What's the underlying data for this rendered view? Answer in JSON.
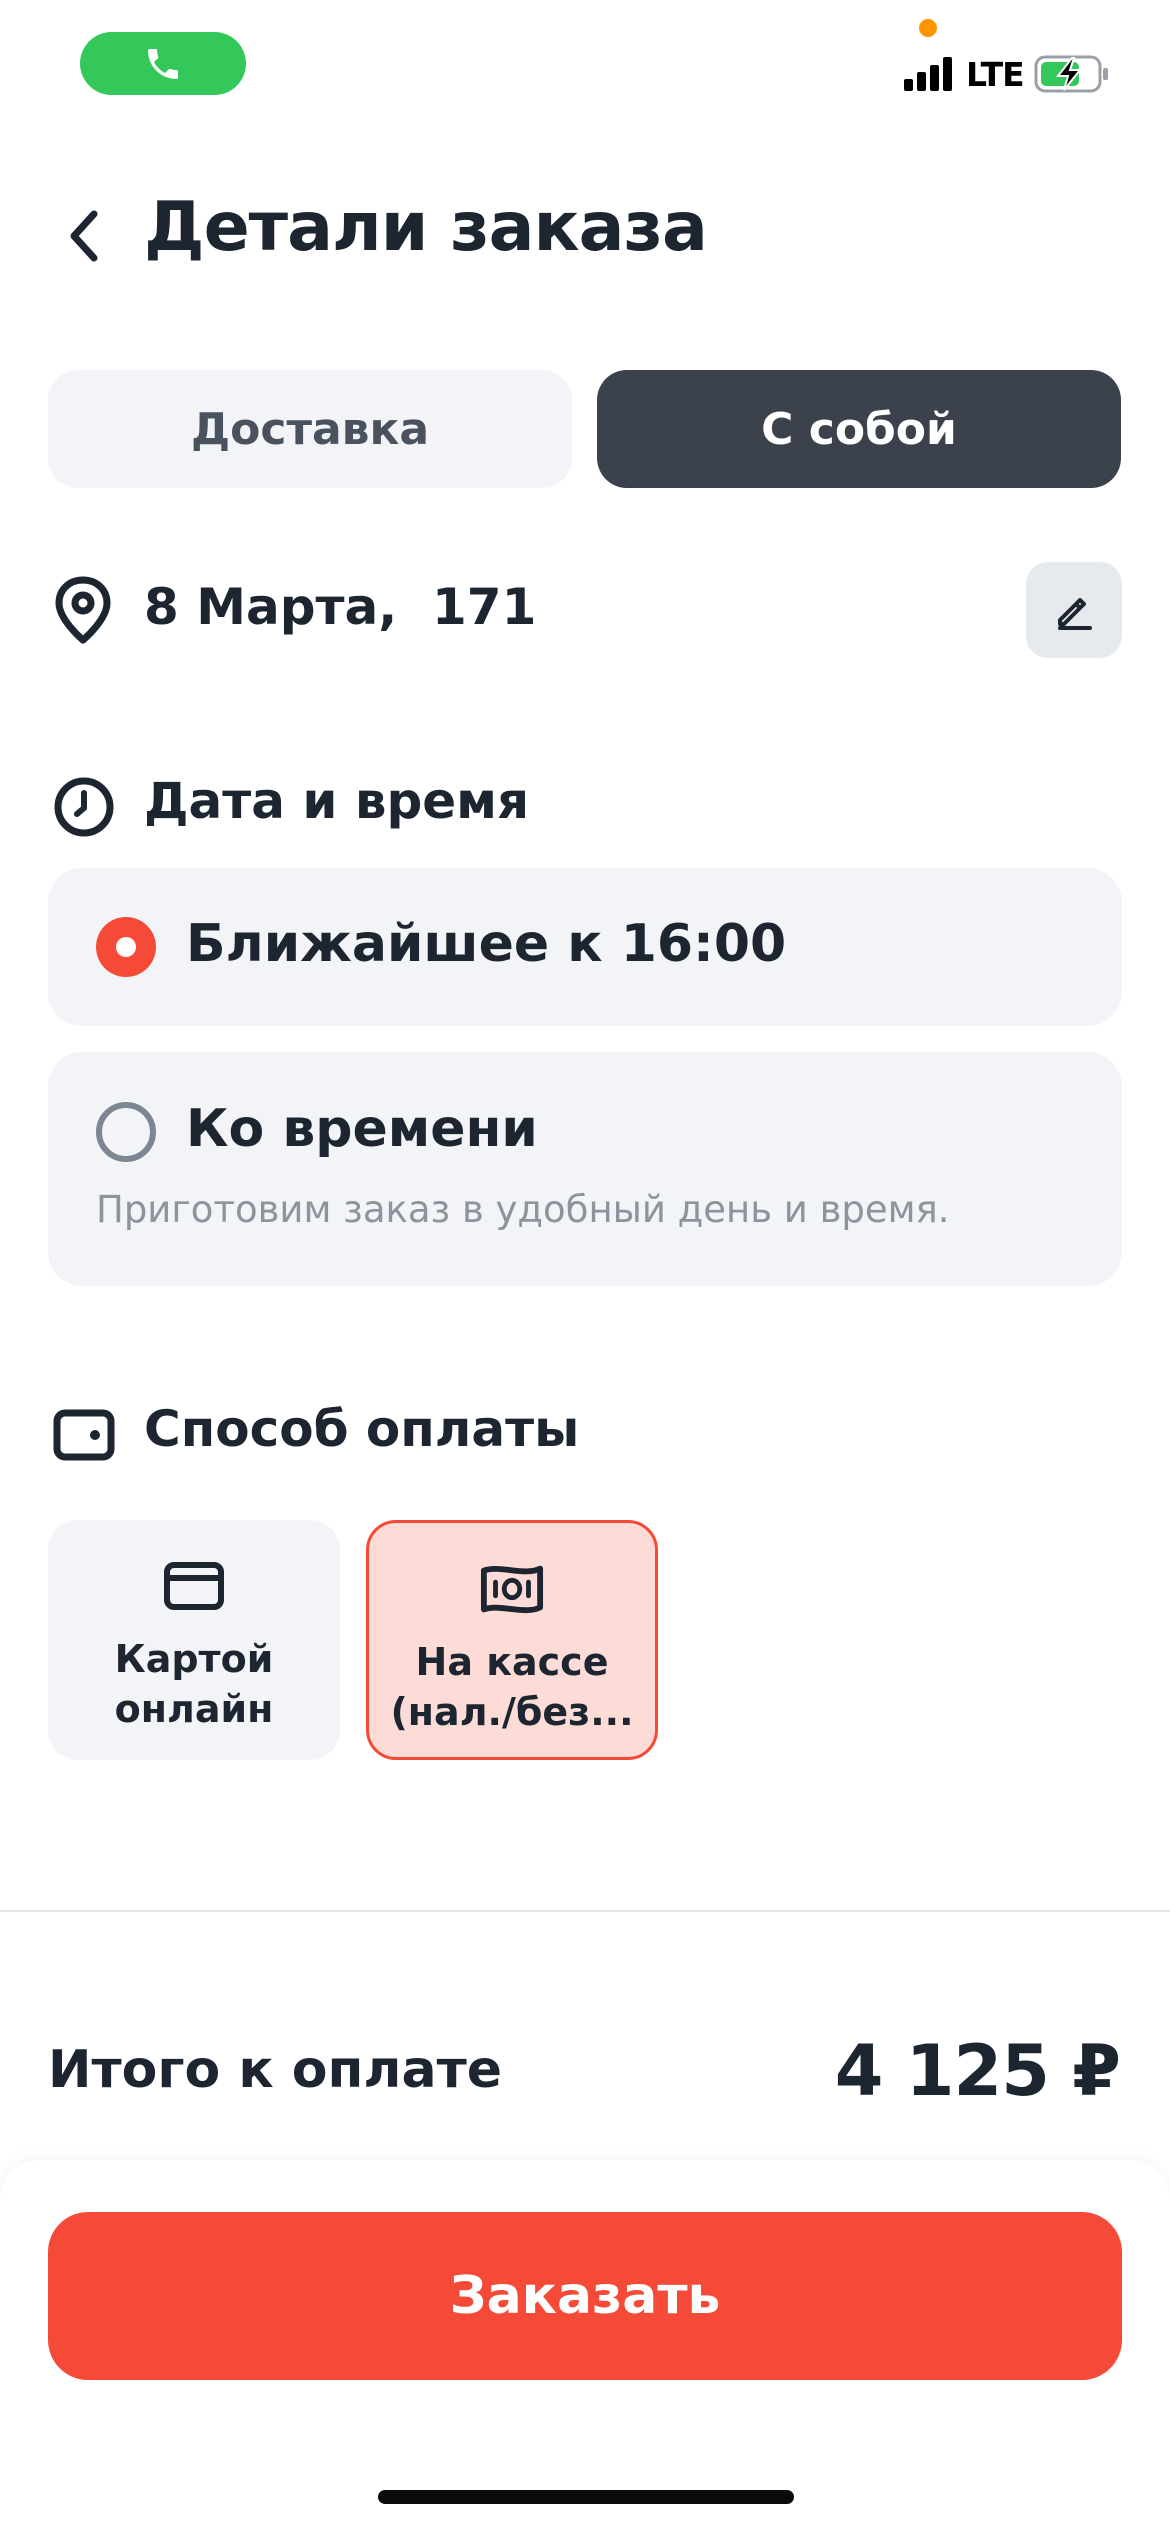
{
  "status_bar": {
    "network": "LTE",
    "call_icon": "phone-icon",
    "signal_icon": "cellular-signal-icon",
    "battery_icon": "battery-charging-icon"
  },
  "header": {
    "title": "Детали заказа",
    "back_icon": "chevron-left-icon"
  },
  "tabs": [
    {
      "label": "Доставка",
      "selected": false
    },
    {
      "label": "С собой",
      "selected": true
    }
  ],
  "address": {
    "text": "8 Марта,  171",
    "icon": "map-pin-icon",
    "edit_icon": "pencil-icon"
  },
  "datetime": {
    "title": "Дата и время",
    "icon": "clock-icon",
    "options": [
      {
        "label": "Ближайшее к 16:00",
        "selected": true
      },
      {
        "label": "Ко времени",
        "description": "Приготовим заказ в удобный день и время.",
        "selected": false
      }
    ]
  },
  "payment": {
    "title": "Способ оплаты",
    "icon": "wallet-icon",
    "methods": [
      {
        "label": "Картой\nонлайн",
        "icon": "credit-card-icon",
        "selected": false
      },
      {
        "label": "На кассе\n(нал./без...",
        "icon": "cash-icon",
        "selected": true
      }
    ]
  },
  "total": {
    "label": "Итого к оплате",
    "value": "4 125 ₽"
  },
  "order_button": {
    "label": "Заказать"
  },
  "colors": {
    "accent": "#f64a38",
    "dark": "#3b424b",
    "card_bg": "#f2f4f7",
    "call_green": "#34c759"
  }
}
